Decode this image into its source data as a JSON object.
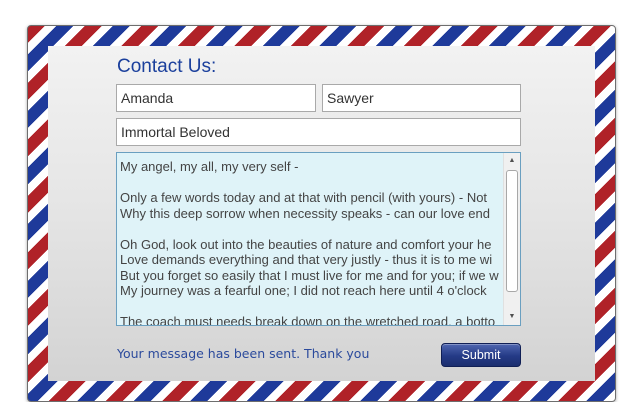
{
  "form": {
    "title": "Contact Us:",
    "first_name": "Amanda",
    "last_name": "Sawyer",
    "subject": "Immortal Beloved",
    "message_lines": [
      "My angel, my all, my very self -",
      "",
      "Only a few words today and at that with pencil (with yours) - Not",
      "Why this deep sorrow when necessity speaks - can our love end",
      "",
      "Oh God, look out into the beauties of nature and comfort your he",
      "Love demands everything and that very justly - thus it is to me wi",
      "But you forget so easily that I must live for me and for you; if we w",
      "My journey was a fearful one; I did not reach here until 4 o'clock",
      "",
      "The coach must needs break down on the wretched road, a botto"
    ],
    "status_message": "Your message has been sent. Thank you",
    "submit_label": "Submit"
  },
  "colors": {
    "stripe_red": "#b02228",
    "stripe_blue": "#1e3a9a",
    "title_blue": "#1a3f9c",
    "textarea_bg": "#dff3f8",
    "button_navy": "#243a86"
  },
  "icons": {
    "scroll_up": "scroll-up-arrow-icon",
    "scroll_down": "scroll-down-arrow-icon"
  }
}
